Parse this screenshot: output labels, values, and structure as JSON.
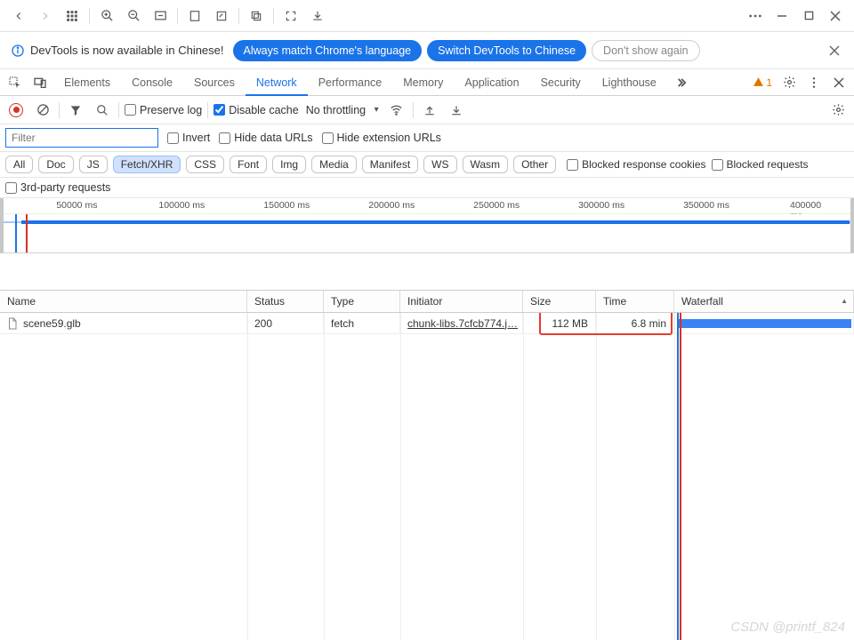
{
  "banner": {
    "message": "DevTools is now available in Chinese!",
    "btn_match": "Always match Chrome's language",
    "btn_switch": "Switch DevTools to Chinese",
    "btn_dismiss": "Don't show again"
  },
  "tabs": {
    "items": [
      "Elements",
      "Console",
      "Sources",
      "Network",
      "Performance",
      "Memory",
      "Application",
      "Security",
      "Lighthouse"
    ],
    "active": "Network",
    "warning_count": "1"
  },
  "toolbar": {
    "preserve_log": "Preserve log",
    "disable_cache": "Disable cache",
    "throttling": "No throttling"
  },
  "filters": {
    "placeholder": "Filter",
    "invert": "Invert",
    "hide_data": "Hide data URLs",
    "hide_ext": "Hide extension URLs",
    "types": [
      "All",
      "Doc",
      "JS",
      "Fetch/XHR",
      "CSS",
      "Font",
      "Img",
      "Media",
      "Manifest",
      "WS",
      "Wasm",
      "Other"
    ],
    "type_active": "Fetch/XHR",
    "blocked_cookies": "Blocked response cookies",
    "blocked_requests": "Blocked requests",
    "third_party": "3rd-party requests"
  },
  "timeline": {
    "ticks": [
      "50000 ms",
      "100000 ms",
      "150000 ms",
      "200000 ms",
      "250000 ms",
      "300000 ms",
      "350000 ms",
      "400000 ms"
    ]
  },
  "table": {
    "headers": {
      "name": "Name",
      "status": "Status",
      "type": "Type",
      "initiator": "Initiator",
      "size": "Size",
      "time": "Time",
      "waterfall": "Waterfall"
    },
    "rows": [
      {
        "name": "scene59.glb",
        "status": "200",
        "type": "fetch",
        "initiator": "chunk-libs.7cfcb774.j…",
        "size": "112 MB",
        "time": "6.8 min"
      }
    ]
  },
  "watermark": "CSDN @printf_824"
}
